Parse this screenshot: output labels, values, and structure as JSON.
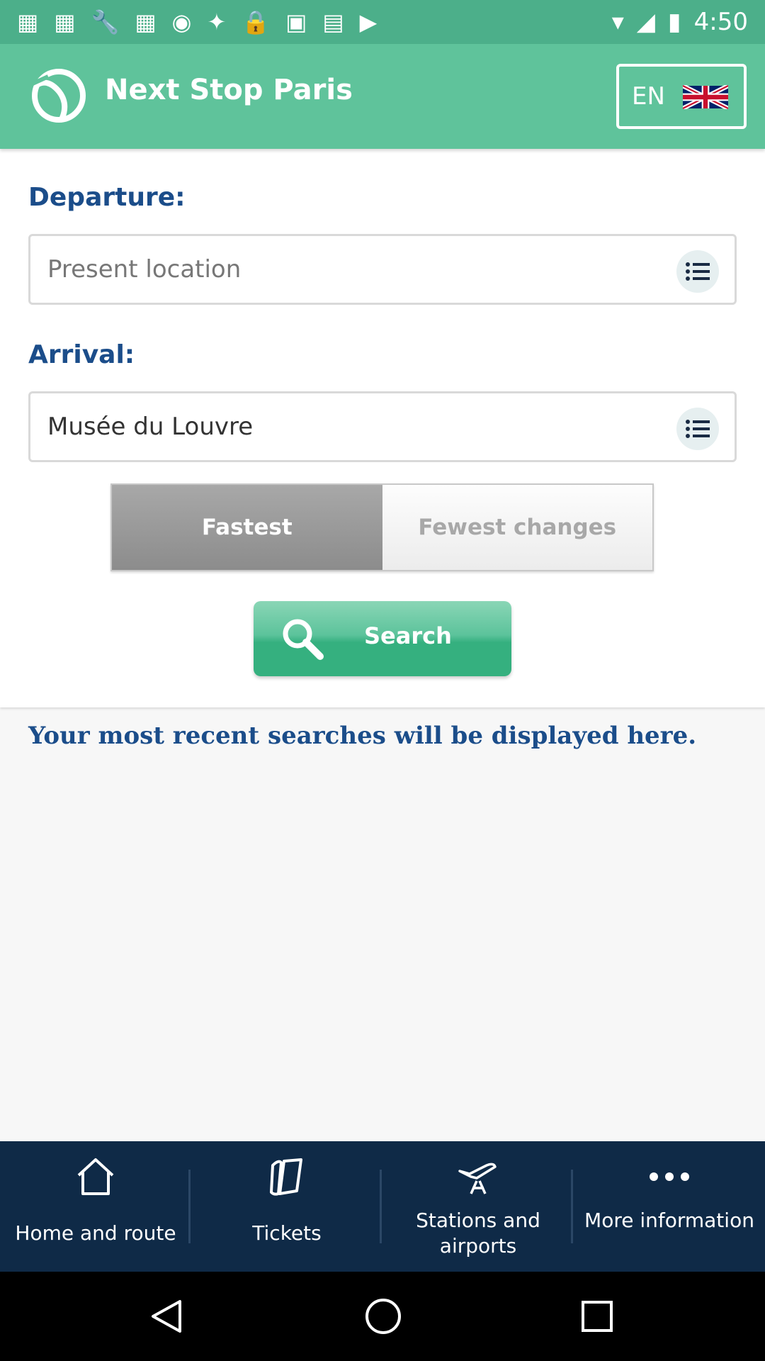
{
  "status_bar": {
    "time": "4:50"
  },
  "header": {
    "title": "Next Stop Paris",
    "language": "EN"
  },
  "form": {
    "departure_label": "Departure:",
    "departure_placeholder": "Present location",
    "arrival_label": "Arrival:",
    "arrival_value": "Musée du Louvre",
    "options": [
      {
        "label": "Fastest",
        "selected": true
      },
      {
        "label": "Fewest changes",
        "selected": false
      }
    ],
    "search_label": "Search"
  },
  "recent_message": "Your most recent searches will be displayed here.",
  "bottom_nav": {
    "items": [
      {
        "label": "Home and route",
        "icon": "home-icon"
      },
      {
        "label": "Tickets",
        "icon": "ticket-icon"
      },
      {
        "label": "Stations and airports",
        "icon": "plane-rail-icon"
      },
      {
        "label": "More information",
        "icon": "more-dots-icon"
      }
    ]
  },
  "colors": {
    "appbar": "#5fc39b",
    "statusbar": "#4caf8a",
    "label_blue": "#1b4d8a",
    "nav_bg": "#0f2a47",
    "search_green": "#35b07f"
  }
}
